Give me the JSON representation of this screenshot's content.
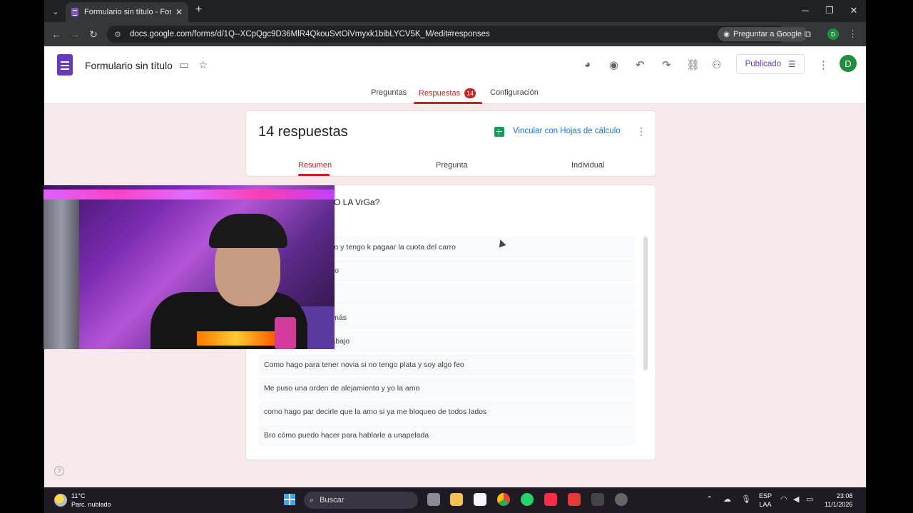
{
  "browser": {
    "tab_title": "Formulario sin título - Formular",
    "url": "docs.google.com/forms/d/1Q--XCpQgc9D36MlR4QkouSvtOiVmyxk1bibLYCV5K_M/edit#responses",
    "ask_google_label": "Preguntar a Google",
    "profile_initial": "D"
  },
  "form": {
    "title": "Formulario sin título",
    "publish_label": "Publicado",
    "avatar_initial": "D",
    "tabs": {
      "questions": "Preguntas",
      "responses": "Respuestas",
      "responses_count": "14",
      "settings": "Configuración"
    }
  },
  "summary": {
    "count_label": "14 respuestas",
    "link_sheets_label": "Vincular con Hojas de cálculo",
    "subtabs": {
      "summary": "Resumen",
      "question": "Pregunta",
      "individual": "Individual"
    }
  },
  "question": {
    "title_fragment": "O LA VrGa?",
    "answers": [
      "ello y tengo k pagaar la cuota del carro",
      "rico",
      "",
      "z más",
      "trabajo",
      "Como hago para tener novia si no tengo plata y soy algo feo",
      "Me puso una orden de alejamiento y yo la amo",
      "como hago par decirle que la amo si ya me bloqueo de todos lados",
      "Bro cómo puedo hacer para hablarle a unapelada"
    ]
  },
  "taskbar": {
    "temperature": "11°C",
    "weather": "Parc. nublado",
    "search_label": "Buscar",
    "lang_line1": "ESP",
    "lang_line2": "LAA",
    "time": "23:08",
    "date": "11/1/2026"
  },
  "colors": {
    "accent": "#673ab7",
    "responses_red": "#c5221f",
    "link_blue": "#1a73e8",
    "background_pink": "#f6e9ea"
  }
}
